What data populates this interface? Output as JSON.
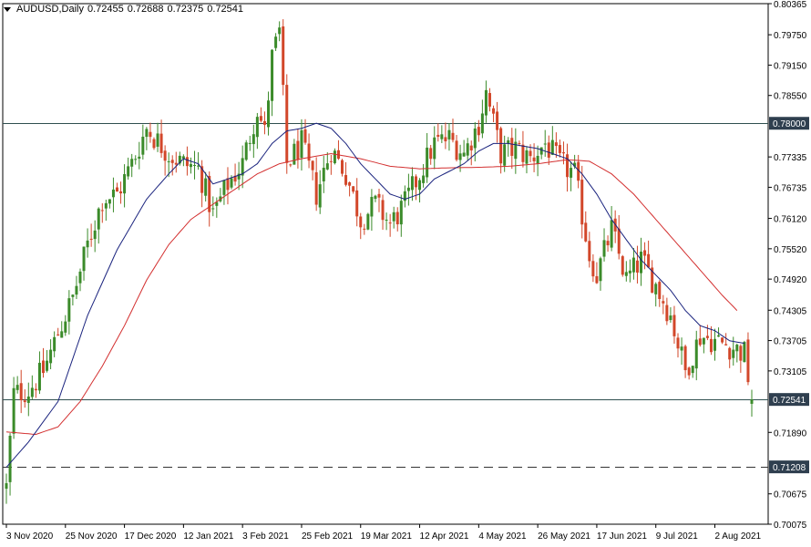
{
  "header": {
    "symbol": "AUDUSD,Daily",
    "open": "0.72455",
    "high": "0.72688",
    "low": "0.72375",
    "close": "0.72541"
  },
  "colors": {
    "background": "#ffffff",
    "frame": "#000000",
    "bull_candle": "#3b8b2a",
    "bear_candle": "#d2472a",
    "ma_fast": "#1a237e",
    "ma_slow": "#d32f2f",
    "hline": "#2f4f4f",
    "price_label_bg": "#2f3f4f",
    "price_label_text": "#ffffff"
  },
  "chart_data": {
    "type": "candlestick",
    "title": "AUDUSD,Daily",
    "ylim": [
      0.70075,
      0.80365
    ],
    "y_ticks": [
      "0.80365",
      "0.79750",
      "0.79150",
      "0.78550",
      "0.77335",
      "0.76735",
      "0.76120",
      "0.75520",
      "0.74920",
      "0.74305",
      "0.73705",
      "0.73105",
      "0.71890",
      "0.70675",
      "0.70075"
    ],
    "x_ticks": [
      {
        "label": "3 Nov 2020",
        "index": 0
      },
      {
        "label": "25 Nov 2020",
        "index": 16
      },
      {
        "label": "17 Dec 2020",
        "index": 32
      },
      {
        "label": "12 Jan 2021",
        "index": 48
      },
      {
        "label": "3 Feb 2021",
        "index": 64
      },
      {
        "label": "25 Feb 2021",
        "index": 80
      },
      {
        "label": "19 Mar 2021",
        "index": 96
      },
      {
        "label": "12 Apr 2021",
        "index": 112
      },
      {
        "label": "4 May 2021",
        "index": 128
      },
      {
        "label": "26 May 2021",
        "index": 144
      },
      {
        "label": "17 Jun 2021",
        "index": 160
      },
      {
        "label": "9 Jul 2021",
        "index": 176
      },
      {
        "label": "2 Aug 2021",
        "index": 192
      }
    ],
    "num_bars": 203,
    "anchors": [
      [
        0,
        0.708
      ],
      [
        2,
        0.7265
      ],
      [
        6,
        0.7272
      ],
      [
        10,
        0.731
      ],
      [
        14,
        0.7385
      ],
      [
        18,
        0.7455
      ],
      [
        22,
        0.756
      ],
      [
        26,
        0.765
      ],
      [
        30,
        0.766
      ],
      [
        34,
        0.772
      ],
      [
        38,
        0.779
      ],
      [
        44,
        0.774
      ],
      [
        48,
        0.772
      ],
      [
        52,
        0.771
      ],
      [
        56,
        0.762
      ],
      [
        60,
        0.768
      ],
      [
        64,
        0.772
      ],
      [
        68,
        0.783
      ],
      [
        70,
        0.778
      ],
      [
        72,
        0.793
      ],
      [
        74,
        0.798
      ],
      [
        76,
        0.772
      ],
      [
        80,
        0.776
      ],
      [
        84,
        0.766
      ],
      [
        88,
        0.775
      ],
      [
        92,
        0.77
      ],
      [
        96,
        0.761
      ],
      [
        100,
        0.764
      ],
      [
        104,
        0.76
      ],
      [
        108,
        0.764
      ],
      [
        112,
        0.77
      ],
      [
        116,
        0.776
      ],
      [
        120,
        0.777
      ],
      [
        124,
        0.774
      ],
      [
        128,
        0.78
      ],
      [
        130,
        0.786
      ],
      [
        134,
        0.774
      ],
      [
        138,
        0.775
      ],
      [
        142,
        0.773
      ],
      [
        146,
        0.776
      ],
      [
        150,
        0.772
      ],
      [
        154,
        0.77
      ],
      [
        158,
        0.754
      ],
      [
        160,
        0.75
      ],
      [
        164,
        0.759
      ],
      [
        168,
        0.749
      ],
      [
        172,
        0.753
      ],
      [
        176,
        0.748
      ],
      [
        180,
        0.742
      ],
      [
        184,
        0.731
      ],
      [
        188,
        0.738
      ],
      [
        192,
        0.737
      ],
      [
        196,
        0.736
      ],
      [
        200,
        0.7345
      ],
      [
        202,
        0.7254
      ]
    ],
    "ma_fast_anchors": [
      [
        0,
        0.712
      ],
      [
        6,
        0.717
      ],
      [
        14,
        0.725
      ],
      [
        22,
        0.742
      ],
      [
        30,
        0.755
      ],
      [
        38,
        0.765
      ],
      [
        44,
        0.77
      ],
      [
        48,
        0.773
      ],
      [
        52,
        0.772
      ],
      [
        56,
        0.768
      ],
      [
        60,
        0.769
      ],
      [
        64,
        0.77
      ],
      [
        68,
        0.772
      ],
      [
        72,
        0.776
      ],
      [
        76,
        0.7785
      ],
      [
        80,
        0.779
      ],
      [
        84,
        0.78
      ],
      [
        88,
        0.779
      ],
      [
        92,
        0.776
      ],
      [
        96,
        0.772
      ],
      [
        100,
        0.769
      ],
      [
        104,
        0.766
      ],
      [
        108,
        0.765
      ],
      [
        112,
        0.766
      ],
      [
        116,
        0.769
      ],
      [
        120,
        0.7705
      ],
      [
        124,
        0.772
      ],
      [
        128,
        0.7745
      ],
      [
        132,
        0.776
      ],
      [
        136,
        0.776
      ],
      [
        140,
        0.7755
      ],
      [
        144,
        0.775
      ],
      [
        148,
        0.774
      ],
      [
        152,
        0.773
      ],
      [
        156,
        0.77
      ],
      [
        160,
        0.766
      ],
      [
        164,
        0.761
      ],
      [
        168,
        0.757
      ],
      [
        172,
        0.753
      ],
      [
        176,
        0.75
      ],
      [
        180,
        0.747
      ],
      [
        184,
        0.743
      ],
      [
        188,
        0.74
      ],
      [
        192,
        0.739
      ],
      [
        196,
        0.737
      ],
      [
        200,
        0.7365
      ]
    ],
    "ma_slow_anchors": [
      [
        0,
        0.719
      ],
      [
        8,
        0.7185
      ],
      [
        14,
        0.72
      ],
      [
        20,
        0.725
      ],
      [
        26,
        0.732
      ],
      [
        32,
        0.74
      ],
      [
        38,
        0.749
      ],
      [
        44,
        0.756
      ],
      [
        50,
        0.761
      ],
      [
        56,
        0.764
      ],
      [
        62,
        0.767
      ],
      [
        68,
        0.77
      ],
      [
        74,
        0.772
      ],
      [
        80,
        0.773
      ],
      [
        88,
        0.774
      ],
      [
        96,
        0.773
      ],
      [
        104,
        0.7715
      ],
      [
        112,
        0.771
      ],
      [
        120,
        0.7712
      ],
      [
        128,
        0.7713
      ],
      [
        136,
        0.7715
      ],
      [
        144,
        0.772
      ],
      [
        152,
        0.7728
      ],
      [
        158,
        0.7725
      ],
      [
        164,
        0.77
      ],
      [
        170,
        0.766
      ],
      [
        176,
        0.761
      ],
      [
        182,
        0.756
      ],
      [
        188,
        0.751
      ],
      [
        194,
        0.746
      ],
      [
        198,
        0.743
      ]
    ],
    "horizontal_lines": [
      {
        "price": 0.78,
        "label": "0.78000",
        "style": "solid"
      },
      {
        "price": 0.72541,
        "label": "0.72541",
        "style": "solid"
      },
      {
        "price": 0.71208,
        "label": "0.71208",
        "style": "dashed"
      }
    ]
  }
}
